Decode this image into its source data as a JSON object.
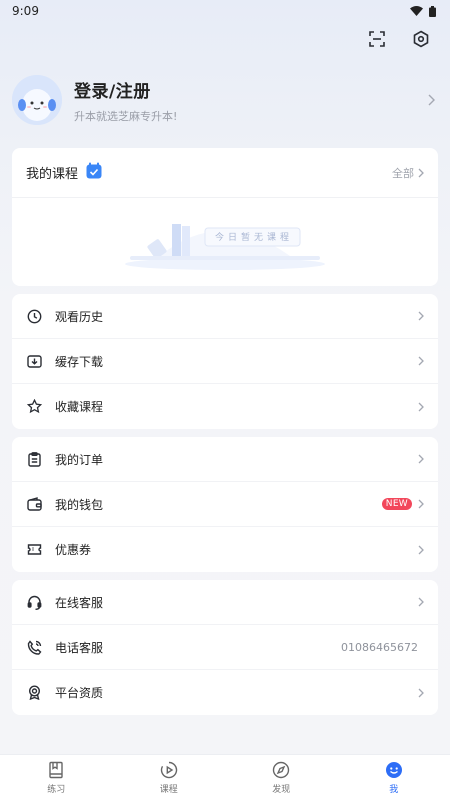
{
  "status": {
    "time": "9:09"
  },
  "topbar": {
    "icons": [
      "scan-icon",
      "settings-hex-icon"
    ]
  },
  "profile": {
    "title": "登录/注册",
    "subtitle": "升本就选芝麻专升本!"
  },
  "courses": {
    "title": "我的课程",
    "all_label": "全部",
    "empty_text": "今日暂无课程"
  },
  "menu_groups": [
    [
      {
        "label": "观看历史",
        "icon": "clock-icon"
      },
      {
        "label": "缓存下载",
        "icon": "download-icon"
      },
      {
        "label": "收藏课程",
        "icon": "star-icon"
      }
    ],
    [
      {
        "label": "我的订单",
        "icon": "clipboard-icon"
      },
      {
        "label": "我的钱包",
        "icon": "wallet-icon",
        "badge": "NEW"
      },
      {
        "label": "优惠券",
        "icon": "coupon-icon"
      }
    ],
    [
      {
        "label": "在线客服",
        "icon": "headset-icon"
      },
      {
        "label": "电话客服",
        "icon": "phone-icon",
        "value": "01086465672"
      },
      {
        "label": "平台资质",
        "icon": "certificate-icon"
      }
    ]
  ],
  "tabs": [
    {
      "label": "练习",
      "icon": "book-icon"
    },
    {
      "label": "课程",
      "icon": "play-circle-icon"
    },
    {
      "label": "发现",
      "icon": "compass-icon"
    },
    {
      "label": "我",
      "icon": "smile-face-icon",
      "active": true
    }
  ],
  "colors": {
    "accent": "#2d6df6",
    "badge": "#f2475b",
    "background": "#f4f5f8"
  }
}
